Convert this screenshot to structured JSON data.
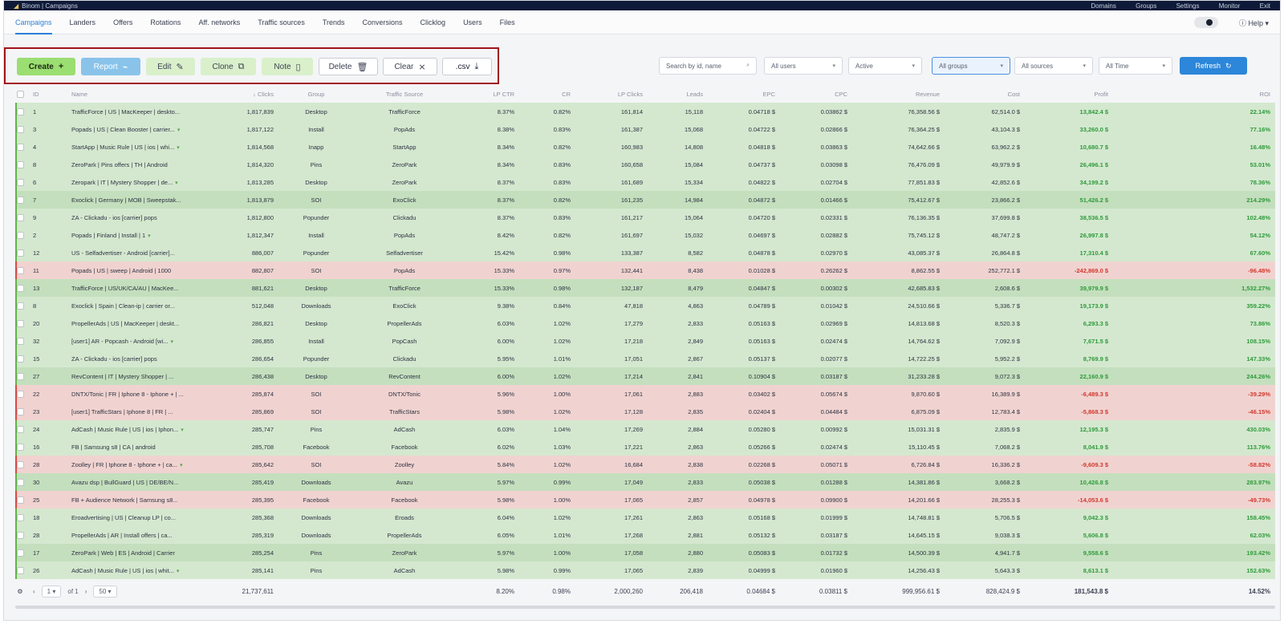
{
  "topbar": {
    "breadcrumb": "Binom | Campaigns",
    "menu": [
      "Domains",
      "Groups",
      "Settings",
      "Monitor",
      "Exit"
    ]
  },
  "nav": {
    "tabs": [
      "Campaigns",
      "Landers",
      "Offers",
      "Rotations",
      "Aff. networks",
      "Traffic sources",
      "Trends",
      "Conversions",
      "Clicklog",
      "Users",
      "Files"
    ],
    "help_label": "Help"
  },
  "toolbar": {
    "create": "Create",
    "report": "Report",
    "edit": "Edit",
    "clone": "Clone",
    "note": "Note",
    "delete": "Delete",
    "clear": "Clear",
    "csv": ".csv"
  },
  "filters": {
    "search_placeholder": "Search by id, name",
    "users": "All users",
    "status": "Active",
    "groups": "All groups",
    "sources": "All sources",
    "time": "All Time",
    "refresh": "Refresh"
  },
  "colors": {
    "accent": "#2c86d9",
    "create": "#9bde72",
    "positive": "#2f9a3c",
    "negative": "#d2382f",
    "highlight_box": "#a3141b"
  },
  "table": {
    "headers": [
      "",
      "ID",
      "Name",
      "Clicks",
      "Group",
      "Traffic Source",
      "LP CTR",
      "CR",
      "LP Clicks",
      "Leads",
      "EPC",
      "CPC",
      "Revenue",
      "Cost",
      "Profit",
      "ROI"
    ],
    "rows": [
      {
        "id": "1",
        "name": "TrafficForce | US | MacKeeper | deskto...",
        "clicks": "1,817,839",
        "group": "Desktop",
        "source": "TrafficForce",
        "lpctr": "8.37%",
        "cr": "0.82%",
        "lpclicks": "161,814",
        "leads": "15,118",
        "epc": "0.04718 $",
        "cpc": "0.03862 $",
        "revenue": "76,358.56 $",
        "cost": "62,514.0 $",
        "profit": "13,842.4 $",
        "roi": "22.14%",
        "tone": "g",
        "star": false
      },
      {
        "id": "3",
        "name": "Popads | US | Clean Booster | carrier...",
        "clicks": "1,817,122",
        "group": "Install",
        "source": "PopAds",
        "lpctr": "8.38%",
        "cr": "0.83%",
        "lpclicks": "161,387",
        "leads": "15,068",
        "epc": "0.04722 $",
        "cpc": "0.02866 $",
        "revenue": "76,364.25 $",
        "cost": "43,104.3 $",
        "profit": "33,260.0 $",
        "roi": "77.16%",
        "tone": "g",
        "star": true
      },
      {
        "id": "4",
        "name": "StartApp | Music Rule | US | ios | whi...",
        "clicks": "1,814,568",
        "group": "Inapp",
        "source": "StartApp",
        "lpctr": "8.34%",
        "cr": "0.82%",
        "lpclicks": "160,983",
        "leads": "14,808",
        "epc": "0.04818 $",
        "cpc": "0.03863 $",
        "revenue": "74,642.66 $",
        "cost": "63,962.2 $",
        "profit": "10,680.7 $",
        "roi": "16.48%",
        "tone": "g",
        "star": true
      },
      {
        "id": "8",
        "name": "ZeroPark | Pins offers | TH | Android",
        "clicks": "1,814,320",
        "group": "Pins",
        "source": "ZeroPark",
        "lpctr": "8.34%",
        "cr": "0.83%",
        "lpclicks": "160,658",
        "leads": "15,084",
        "epc": "0.04737 $",
        "cpc": "0.03098 $",
        "revenue": "76,476.09 $",
        "cost": "49,979.9 $",
        "profit": "26,496.1 $",
        "roi": "53.01%",
        "tone": "g",
        "star": false
      },
      {
        "id": "6",
        "name": "Zeropark | IT | Mystery Shopper | de...",
        "clicks": "1,813,285",
        "group": "Desktop",
        "source": "ZeroPark",
        "lpctr": "8.37%",
        "cr": "0.83%",
        "lpclicks": "161,689",
        "leads": "15,334",
        "epc": "0.04822 $",
        "cpc": "0.02704 $",
        "revenue": "77,851.83 $",
        "cost": "42,852.6 $",
        "profit": "34,199.2 $",
        "roi": "78.36%",
        "tone": "g",
        "star": true
      },
      {
        "id": "7",
        "name": "Exoclick | Germany | MOB | Sweepstak...",
        "clicks": "1,813,879",
        "group": "SOI",
        "source": "ExoClick",
        "lpctr": "8.37%",
        "cr": "0.82%",
        "lpclicks": "161,235",
        "leads": "14,984",
        "epc": "0.04872 $",
        "cpc": "0.01466 $",
        "revenue": "75,412.67 $",
        "cost": "23,866.2 $",
        "profit": "51,426.2 $",
        "roi": "214.29%",
        "tone": "g2",
        "star": false
      },
      {
        "id": "9",
        "name": "ZA - Clickadu - ios [carrier] pops",
        "clicks": "1,812,800",
        "group": "Popunder",
        "source": "Clickadu",
        "lpctr": "8.37%",
        "cr": "0.83%",
        "lpclicks": "161,217",
        "leads": "15,064",
        "epc": "0.04720 $",
        "cpc": "0.02331 $",
        "revenue": "76,136.35 $",
        "cost": "37,699.8 $",
        "profit": "38,536.5 $",
        "roi": "102.48%",
        "tone": "g",
        "star": false
      },
      {
        "id": "2",
        "name": "Popads | Finland | Install | 1",
        "clicks": "1,812,347",
        "group": "Install",
        "source": "PopAds",
        "lpctr": "8.42%",
        "cr": "0.82%",
        "lpclicks": "161,697",
        "leads": "15,032",
        "epc": "0.04697 $",
        "cpc": "0.02882 $",
        "revenue": "75,745.12 $",
        "cost": "48,747.2 $",
        "profit": "26,997.8 $",
        "roi": "54.12%",
        "tone": "g",
        "star": true
      },
      {
        "id": "12",
        "name": "US - Selfadvertiser - Android [carrier]...",
        "clicks": "886,007",
        "group": "Popunder",
        "source": "Selfadvertiser",
        "lpctr": "15.42%",
        "cr": "0.98%",
        "lpclicks": "133,387",
        "leads": "8,582",
        "epc": "0.04878 $",
        "cpc": "0.02970 $",
        "revenue": "43,085.37 $",
        "cost": "26,864.8 $",
        "profit": "17,310.4 $",
        "roi": "67.60%",
        "tone": "g",
        "star": false
      },
      {
        "id": "11",
        "name": "Popads | US | sweep | Android | 1000",
        "clicks": "882,807",
        "group": "SOI",
        "source": "PopAds",
        "lpctr": "15.33%",
        "cr": "0.97%",
        "lpclicks": "132,441",
        "leads": "8,438",
        "epc": "0.01028 $",
        "cpc": "0.26262 $",
        "revenue": "8,862.55 $",
        "cost": "252,772.1 $",
        "profit": "-242,869.0 $",
        "roi": "-96.48%",
        "tone": "r",
        "star": false
      },
      {
        "id": "13",
        "name": "TrafficForce | US/UK/CA/AU | MacKee...",
        "clicks": "881,621",
        "group": "Desktop",
        "source": "TrafficForce",
        "lpctr": "15.33%",
        "cr": "0.98%",
        "lpclicks": "132,187",
        "leads": "8,479",
        "epc": "0.04847 $",
        "cpc": "0.00302 $",
        "revenue": "42,685.83 $",
        "cost": "2,608.6 $",
        "profit": "39,979.9 $",
        "roi": "1,532.27%",
        "tone": "g2",
        "star": false
      },
      {
        "id": "8",
        "name": "Exoclick | Spain | Clean-ip | carrier or...",
        "clicks": "512,048",
        "group": "Downloads",
        "source": "ExoClick",
        "lpctr": "9.38%",
        "cr": "0.84%",
        "lpclicks": "47,818",
        "leads": "4,863",
        "epc": "0.04789 $",
        "cpc": "0.01042 $",
        "revenue": "24,510.66 $",
        "cost": "5,336.7 $",
        "profit": "19,173.9 $",
        "roi": "359.22%",
        "tone": "g",
        "star": false
      },
      {
        "id": "20",
        "name": "PropellerAds | US | MacKeeper | deskt...",
        "clicks": "286,821",
        "group": "Desktop",
        "source": "PropellerAds",
        "lpctr": "6.03%",
        "cr": "1.02%",
        "lpclicks": "17,279",
        "leads": "2,833",
        "epc": "0.05163 $",
        "cpc": "0.02969 $",
        "revenue": "14,813.68 $",
        "cost": "8,520.3 $",
        "profit": "6,293.3 $",
        "roi": "73.86%",
        "tone": "g",
        "star": false
      },
      {
        "id": "32",
        "name": "[user1] AR - Popcash - Android [wi...",
        "clicks": "286,855",
        "group": "Install",
        "source": "PopCash",
        "lpctr": "6.00%",
        "cr": "1.02%",
        "lpclicks": "17,218",
        "leads": "2,849",
        "epc": "0.05163 $",
        "cpc": "0.02474 $",
        "revenue": "14,764.62 $",
        "cost": "7,092.9 $",
        "profit": "7,671.5 $",
        "roi": "108.15%",
        "tone": "g",
        "star": true
      },
      {
        "id": "15",
        "name": "ZA - Clickadu - ios [carrier] pops",
        "clicks": "286,654",
        "group": "Popunder",
        "source": "Clickadu",
        "lpctr": "5.95%",
        "cr": "1.01%",
        "lpclicks": "17,051",
        "leads": "2,867",
        "epc": "0.05137 $",
        "cpc": "0.02077 $",
        "revenue": "14,722.25 $",
        "cost": "5,952.2 $",
        "profit": "8,769.9 $",
        "roi": "147.33%",
        "tone": "g",
        "star": false
      },
      {
        "id": "27",
        "name": "RevContent | IT | Mystery Shopper | ...",
        "clicks": "286,438",
        "group": "Desktop",
        "source": "RevContent",
        "lpctr": "6.00%",
        "cr": "1.02%",
        "lpclicks": "17,214",
        "leads": "2,841",
        "epc": "0.10904 $",
        "cpc": "0.03187 $",
        "revenue": "31,233.28 $",
        "cost": "9,072.3 $",
        "profit": "22,160.9 $",
        "roi": "244.26%",
        "tone": "g2",
        "star": false
      },
      {
        "id": "22",
        "name": "DNTX/Tonic | FR | Iphone 8 - Iphone + | ...",
        "clicks": "285,874",
        "group": "SOI",
        "source": "DNTX/Tonic",
        "lpctr": "5.96%",
        "cr": "1.00%",
        "lpclicks": "17,061",
        "leads": "2,883",
        "epc": "0.03402 $",
        "cpc": "0.05674 $",
        "revenue": "9,870.60 $",
        "cost": "16,389.9 $",
        "profit": "-6,489.3 $",
        "roi": "-39.29%",
        "tone": "r",
        "star": false
      },
      {
        "id": "23",
        "name": "[user1] TrafficStars | Iphone 8 | FR | ...",
        "clicks": "285,869",
        "group": "SOI",
        "source": "TrafficStars",
        "lpctr": "5.98%",
        "cr": "1.02%",
        "lpclicks": "17,128",
        "leads": "2,835",
        "epc": "0.02404 $",
        "cpc": "0.04484 $",
        "revenue": "6,875.09 $",
        "cost": "12,783.4 $",
        "profit": "-5,868.3 $",
        "roi": "-46.15%",
        "tone": "r",
        "star": false
      },
      {
        "id": "24",
        "name": "AdCash | Music Rule | US | ios | Iphon...",
        "clicks": "285,747",
        "group": "Pins",
        "source": "AdCash",
        "lpctr": "6.03%",
        "cr": "1.04%",
        "lpclicks": "17,269",
        "leads": "2,884",
        "epc": "0.05280 $",
        "cpc": "0.00992 $",
        "revenue": "15,031.31 $",
        "cost": "2,835.9 $",
        "profit": "12,195.3 $",
        "roi": "430.03%",
        "tone": "g",
        "star": true
      },
      {
        "id": "16",
        "name": "FB | Samsung s8 | CA | android",
        "clicks": "285,708",
        "group": "Facebook",
        "source": "Facebook",
        "lpctr": "6.02%",
        "cr": "1.03%",
        "lpclicks": "17,221",
        "leads": "2,863",
        "epc": "0.05266 $",
        "cpc": "0.02474 $",
        "revenue": "15,110.45 $",
        "cost": "7,068.2 $",
        "profit": "8,041.9 $",
        "roi": "113.76%",
        "tone": "g",
        "star": false
      },
      {
        "id": "28",
        "name": "Zoolley | FR | Iphone 8 - Iphone + | ca...",
        "clicks": "285,642",
        "group": "SOI",
        "source": "Zoolley",
        "lpctr": "5.84%",
        "cr": "1.02%",
        "lpclicks": "16,684",
        "leads": "2,838",
        "epc": "0.02268 $",
        "cpc": "0.05071 $",
        "revenue": "6,726.84 $",
        "cost": "16,336.2 $",
        "profit": "-9,609.3 $",
        "roi": "-58.82%",
        "tone": "r",
        "star": true
      },
      {
        "id": "30",
        "name": "Avazu dsp | BullGuard | US | DE/BE/N...",
        "clicks": "285,419",
        "group": "Downloads",
        "source": "Avazu",
        "lpctr": "5.97%",
        "cr": "0.99%",
        "lpclicks": "17,049",
        "leads": "2,833",
        "epc": "0.05038 $",
        "cpc": "0.01288 $",
        "revenue": "14,381.86 $",
        "cost": "3,668.2 $",
        "profit": "10,426.8 $",
        "roi": "283.97%",
        "tone": "g2",
        "star": false
      },
      {
        "id": "25",
        "name": "FB + Audience Network | Samsung s8...",
        "clicks": "285,395",
        "group": "Facebook",
        "source": "Facebook",
        "lpctr": "5.98%",
        "cr": "1.00%",
        "lpclicks": "17,065",
        "leads": "2,857",
        "epc": "0.04978 $",
        "cpc": "0.09900 $",
        "revenue": "14,201.66 $",
        "cost": "28,255.3 $",
        "profit": "-14,053.6 $",
        "roi": "-49.73%",
        "tone": "r",
        "star": false
      },
      {
        "id": "18",
        "name": "Eroadvertising | US | Cleanup LP | co...",
        "clicks": "285,368",
        "group": "Downloads",
        "source": "Eroads",
        "lpctr": "6.04%",
        "cr": "1.02%",
        "lpclicks": "17,261",
        "leads": "2,863",
        "epc": "0.05168 $",
        "cpc": "0.01999 $",
        "revenue": "14,748.81 $",
        "cost": "5,706.5 $",
        "profit": "9,042.3 $",
        "roi": "158.45%",
        "tone": "g",
        "star": false
      },
      {
        "id": "28",
        "name": "PropellerAds | AR | Install offers | ca...",
        "clicks": "285,319",
        "group": "Downloads",
        "source": "PropellerAds",
        "lpctr": "6.05%",
        "cr": "1.01%",
        "lpclicks": "17,268",
        "leads": "2,881",
        "epc": "0.05132 $",
        "cpc": "0.03187 $",
        "revenue": "14,645.15 $",
        "cost": "9,038.3 $",
        "profit": "5,606.8 $",
        "roi": "62.03%",
        "tone": "g",
        "star": false
      },
      {
        "id": "17",
        "name": "ZeroPark | Web | ES | Android | Carrier",
        "clicks": "285,254",
        "group": "Pins",
        "source": "ZeroPark",
        "lpctr": "5.97%",
        "cr": "1.00%",
        "lpclicks": "17,058",
        "leads": "2,880",
        "epc": "0.05083 $",
        "cpc": "0.01732 $",
        "revenue": "14,500.39 $",
        "cost": "4,941.7 $",
        "profit": "9,558.6 $",
        "roi": "193.42%",
        "tone": "g2",
        "star": false
      },
      {
        "id": "26",
        "name": "AdCash | Music Rule | US | ios | whit...",
        "clicks": "285,141",
        "group": "Pins",
        "source": "AdCash",
        "lpctr": "5.98%",
        "cr": "0.99%",
        "lpclicks": "17,065",
        "leads": "2,839",
        "epc": "0.04999 $",
        "cpc": "0.01960 $",
        "revenue": "14,256.43 $",
        "cost": "5,643.3 $",
        "profit": "8,613.1 $",
        "roi": "152.63%",
        "tone": "g",
        "star": true
      }
    ],
    "totals": {
      "page": "1",
      "of_label": "of 1",
      "per_page": "50",
      "clicks": "21,737,611",
      "lpctr": "8.20%",
      "cr": "0.98%",
      "lpclicks": "2,000,260",
      "leads": "206,418",
      "epc": "0.04684 $",
      "cpc": "0.03811 $",
      "revenue": "999,956.61 $",
      "cost": "828,424.9 $",
      "profit": "181,543.8 $",
      "roi": "14.52%"
    }
  }
}
